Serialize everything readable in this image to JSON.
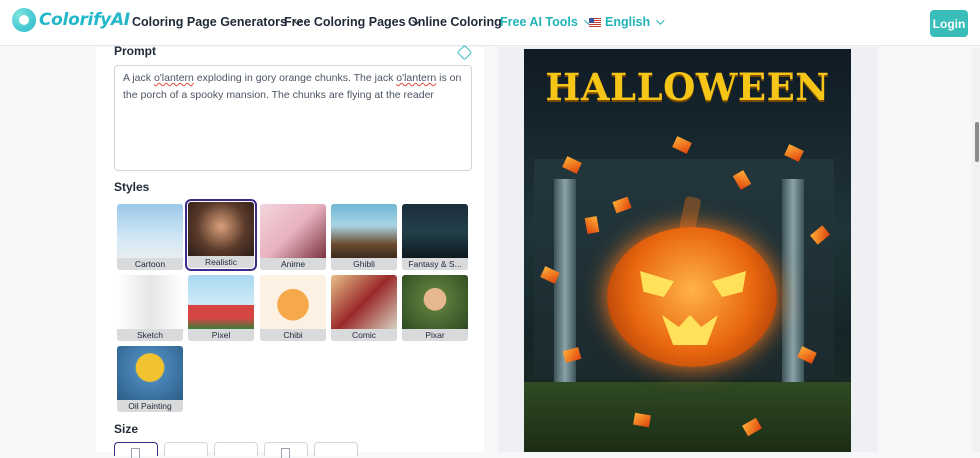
{
  "nav": {
    "logo_text": "ColorifyAI",
    "items": [
      {
        "label": "Coloring Page Generators",
        "dropdown": true
      },
      {
        "label": "Free Coloring Pages",
        "dropdown": true
      },
      {
        "label": "Online Coloring",
        "dropdown": false
      },
      {
        "label": "Free AI Tools",
        "dropdown": true
      },
      {
        "label": "English",
        "dropdown": true
      }
    ],
    "login_label": "Login",
    "accent_color": "#22b3b8"
  },
  "form": {
    "prompt_label": "Prompt",
    "prompt_text_parts": [
      "A jack ",
      "o'lantern",
      " exploding in gory orange chunks. The jack ",
      "o'lantern",
      " is on the porch of a spooky mansion. The chunks are flying at the reader"
    ],
    "styles_label": "Styles",
    "styles": [
      {
        "name": "Cartoon",
        "selected": false
      },
      {
        "name": "Realistic",
        "selected": true
      },
      {
        "name": "Anime",
        "selected": false
      },
      {
        "name": "Ghibli",
        "selected": false
      },
      {
        "name": "Fantasy & S...",
        "selected": false
      },
      {
        "name": "Sketch",
        "selected": false
      },
      {
        "name": "Pixel",
        "selected": false
      },
      {
        "name": "Chibi",
        "selected": false
      },
      {
        "name": "Comic",
        "selected": false
      },
      {
        "name": "Pixar",
        "selected": false
      },
      {
        "name": "Oil Painting",
        "selected": false
      }
    ],
    "size_label": "Size"
  },
  "preview": {
    "title_text": "HALLOWEEN"
  }
}
